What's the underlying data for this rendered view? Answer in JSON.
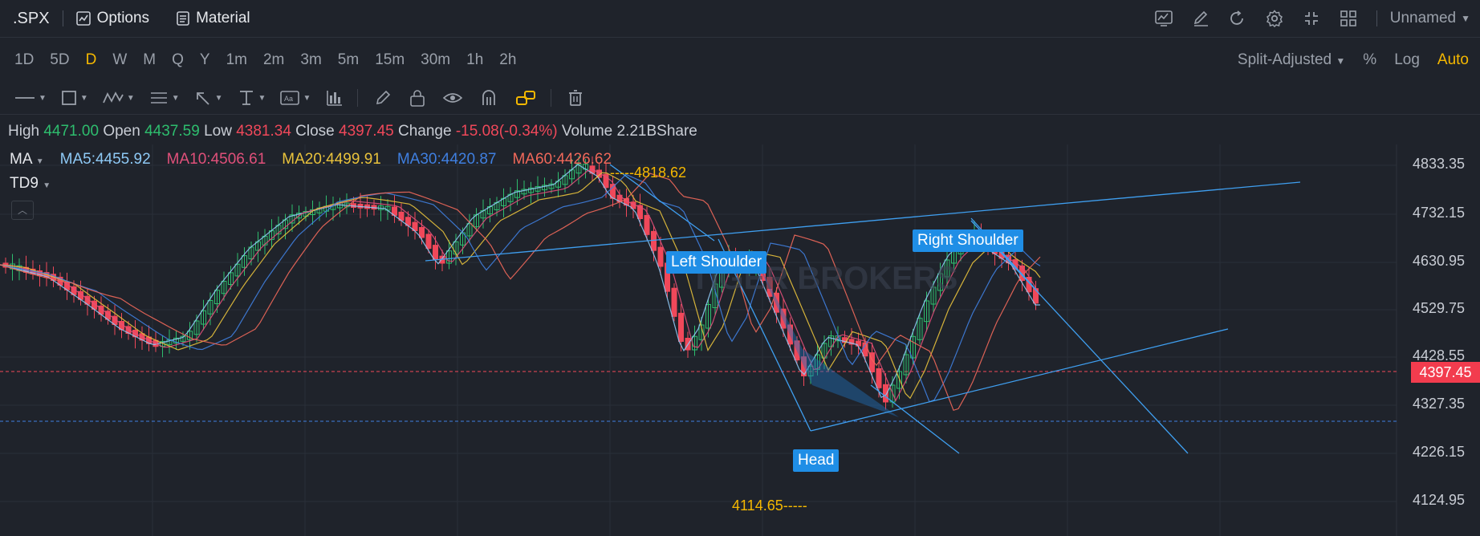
{
  "header": {
    "symbol": ".SPX",
    "options_label": "Options",
    "material_label": "Material",
    "layout_name": "Unnamed"
  },
  "timeframes": [
    "1D",
    "5D",
    "D",
    "W",
    "M",
    "Q",
    "Y",
    "1m",
    "2m",
    "3m",
    "5m",
    "15m",
    "30m",
    "1h",
    "2h"
  ],
  "active_timeframe": "D",
  "chart_options": {
    "adjust": "Split-Adjusted",
    "percent": "%",
    "log": "Log",
    "auto": "Auto"
  },
  "drawing_tools": [
    "trend-line-tool",
    "rectangle-tool",
    "pattern-tool",
    "fib-tool",
    "arrow-tool",
    "measure-tool",
    "text-tool",
    "bar-pattern-tool",
    "pen-tool",
    "lock-tool",
    "eye-tool",
    "magnet-tool",
    "link-tool",
    "trash-tool"
  ],
  "ohlc": {
    "high_label": "High",
    "high": "4471.00",
    "open_label": "Open",
    "open": "4437.59",
    "low_label": "Low",
    "low": "4381.34",
    "close_label": "Close",
    "close": "4397.45",
    "change_label": "Change",
    "change": "-15.08(-0.34%)",
    "volume_label": "Volume",
    "volume": "2.21BShare"
  },
  "indicators": {
    "ma_label": "MA",
    "ma5": "MA5:4455.92",
    "ma10": "MA10:4506.61",
    "ma20": "MA20:4499.91",
    "ma30": "MA30:4420.87",
    "ma60": "MA60:4426.62",
    "td_label": "TD9"
  },
  "colors": {
    "ma5": "#8ec9f5",
    "ma10": "#e0507a",
    "ma20": "#e8c23c",
    "ma30": "#3f7fe0",
    "ma60": "#f0685a",
    "up": "#2ebd6e",
    "down": "#f0485a",
    "annotation": "#1f8ee6"
  },
  "price_axis": [
    "4833.35",
    "4732.15",
    "4630.95",
    "4529.75",
    "4428.55",
    "4327.35",
    "4226.15",
    "4124.95"
  ],
  "current_price": "4397.45",
  "annotations": {
    "left_shoulder": "Left Shoulder",
    "head": "Head",
    "right_shoulder": "Right Shoulder"
  },
  "extremes": {
    "high": "4818.62",
    "low": "4114.65"
  },
  "watermark": "TIGER BROKERS"
}
